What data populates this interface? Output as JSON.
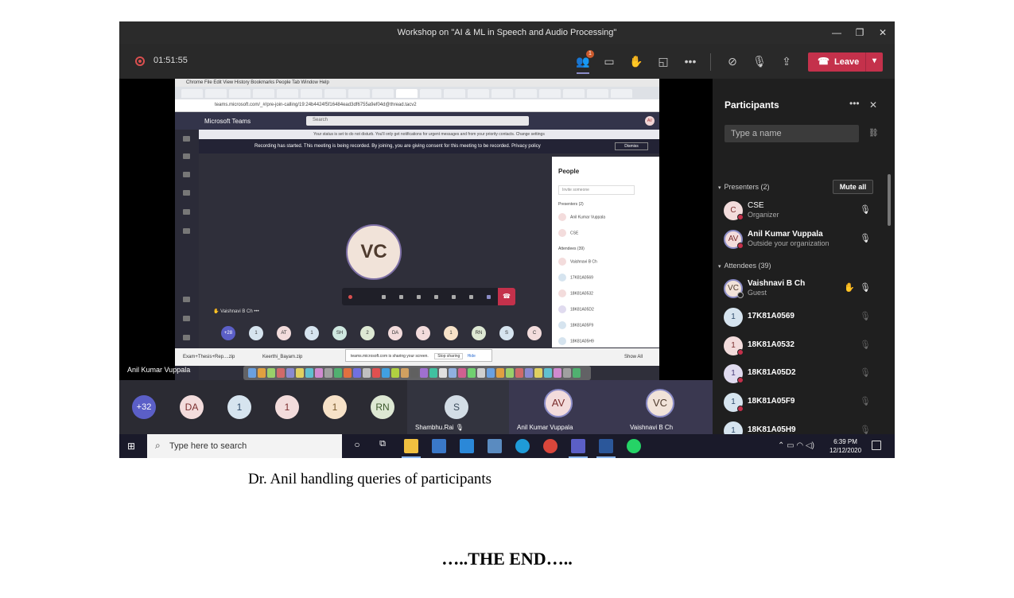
{
  "window": {
    "title": "Workshop on \"AI & ML in Speech and Audio Processing\"",
    "minimize": "—",
    "restore": "❐",
    "close": "✕"
  },
  "meeting": {
    "timer": "01:51:55",
    "people_badge": "1",
    "leave_label": "Leave",
    "colors": {
      "leave": "#c4314b",
      "accent": "#8b8cc7"
    }
  },
  "stage": {
    "presenter_name": "Anil Kumar Vuppala",
    "shared_screen": {
      "mac_menu": "  Chrome   File   Edit   View   History   Bookmarks   People   Tab   Window   Help",
      "url": "teams.microsoft.com/_#/pre-join-calling/19:24b4424f5f16484ead3df6755a9ef04d@thread.tacv2",
      "app_name": "Microsoft Teams",
      "search_placeholder": "Search",
      "status_notice": "Your status is set to do not disturb. You'll only get notifications for urgent messages and from your priority contacts. Change settings",
      "recording_notice": "Recording has started. This meeting is being recorded. By joining, you are giving consent for this meeting to be recorded. Privacy policy",
      "dismiss": "Dismiss",
      "center_avatar": "VC",
      "hand_raised_name": "Vaishnavi B Ch",
      "people_title": "People",
      "invite_placeholder": "Invite someone",
      "presenters_label": "Presenters (2)",
      "attendees_label": "Attendees (39)",
      "people_rows": [
        {
          "initials": "AV",
          "name": "Anil Kumar Vuppala"
        },
        {
          "initials": "C",
          "name": "CSE"
        },
        {
          "initials": "VC",
          "name": "Vaishnavi B Ch"
        },
        {
          "initials": "1",
          "name": "17K81A0569"
        },
        {
          "initials": "1",
          "name": "18K81A0532"
        },
        {
          "initials": "1",
          "name": "18K81A05D2"
        },
        {
          "initials": "1",
          "name": "18K81A05F9"
        },
        {
          "initials": "1",
          "name": "18K81A05H9"
        }
      ],
      "downloads": [
        "Exam+Thesis+Rep....zip",
        "Keerthi_Bayam.zip"
      ],
      "sharing_notice": "teams.microsoft.com is sharing your screen.",
      "stop_sharing": "Stop sharing",
      "hide": "Hide",
      "show_all": "Show All",
      "mini_avatars": [
        "+28",
        "1",
        "AT",
        "1",
        "SH",
        "2",
        "DA",
        "1",
        "1",
        "RN",
        "S",
        "C"
      ]
    }
  },
  "participants": {
    "title": "Participants",
    "search_placeholder": "Type a name",
    "presenters_label": "Presenters (2)",
    "mute_all": "Mute all",
    "attendees_label": "Attendees (39)",
    "presenters": [
      {
        "initials": "C",
        "name": "CSE",
        "role": "Organizer"
      },
      {
        "initials": "AV",
        "name": "Anil Kumar Vuppala",
        "role": "Outside your organization"
      }
    ],
    "attendees": [
      {
        "initials": "VC",
        "name": "Vaishnavi B Ch",
        "role": "Guest"
      },
      {
        "initials": "1",
        "name": "17K81A0569",
        "role": ""
      },
      {
        "initials": "1",
        "name": "18K81A0532",
        "role": ""
      },
      {
        "initials": "1",
        "name": "18K81A05D2",
        "role": ""
      },
      {
        "initials": "1",
        "name": "18K81A05F9",
        "role": ""
      },
      {
        "initials": "1",
        "name": "18K81A05H9",
        "role": ""
      }
    ]
  },
  "filmstrip": {
    "overflow": "+32",
    "avatars": [
      "DA",
      "1",
      "1",
      "1",
      "RN"
    ],
    "tiles": [
      {
        "initials": "S",
        "name": "Shambhu.Rai"
      },
      {
        "initials": "AV",
        "name": "Anil Kumar Vuppala"
      },
      {
        "initials": "VC",
        "name": "Vaishnavi B Ch"
      }
    ]
  },
  "taskbar": {
    "search_placeholder": "Type here to search",
    "time": "6:39 PM",
    "date": "12/12/2020"
  },
  "document": {
    "caption": "Dr. Anil handling queries of participants",
    "the_end": "…..THE END….."
  }
}
